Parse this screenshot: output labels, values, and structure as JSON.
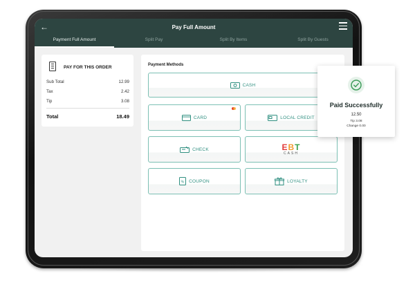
{
  "header": {
    "title": "Pay Full Amount",
    "back_icon": "back-arrow-icon",
    "menu_icon": "hamburger-menu-icon"
  },
  "tabs": [
    {
      "label": "Payment Full Amount",
      "active": true
    },
    {
      "label": "Split Pay",
      "active": false
    },
    {
      "label": "Split By Items",
      "active": false
    },
    {
      "label": "Split By Guests",
      "active": false
    }
  ],
  "order": {
    "title": "PAY FOR THIS ORDER",
    "rows": [
      {
        "label": "Sub Total",
        "value": "12.99"
      },
      {
        "label": "Tax",
        "value": "2.42"
      },
      {
        "label": "Tip",
        "value": "3.08"
      }
    ],
    "total": {
      "label": "Total",
      "value": "18.49"
    }
  },
  "payment": {
    "title": "Payment Methods",
    "methods": {
      "cash": {
        "label": "CASH",
        "icon": "cash-icon"
      },
      "card": {
        "label": "CARD",
        "icon": "card-icon"
      },
      "local_credit": {
        "label": "LOCAL CREDIT",
        "icon": "local-credit-icon"
      },
      "check": {
        "label": "CHECK",
        "icon": "check-icon"
      },
      "ebt": {
        "logo_e": "E",
        "logo_b": "B",
        "logo_t": "T",
        "sub": "CASH"
      },
      "coupon": {
        "label": "COUPON",
        "icon": "coupon-icon"
      },
      "loyalty": {
        "label": "LOYALTY",
        "icon": "loyalty-icon"
      }
    }
  },
  "toast": {
    "title": "Paid Successfully",
    "amount": "12.50",
    "tip": "Tip 3.08",
    "change": "Change 0.00"
  },
  "colors": {
    "topbar": "#2d4541",
    "accent": "#2f8f80",
    "border": "#7bbfb3"
  }
}
